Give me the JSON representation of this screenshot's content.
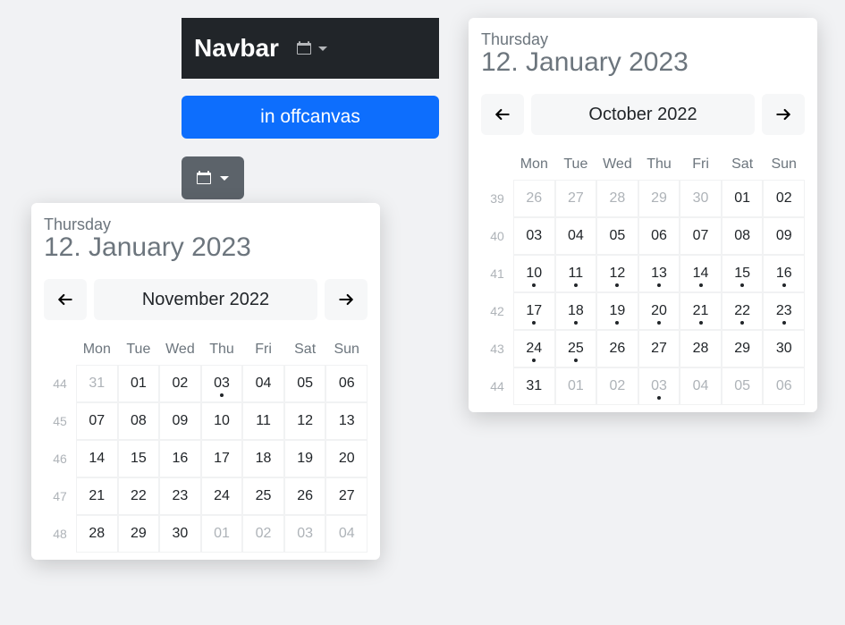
{
  "navbar": {
    "brand": "Navbar"
  },
  "offcanvas_btn": "in offcanvas",
  "picker_header": {
    "weekday": "Thursday",
    "date": "12. January 2023"
  },
  "weekdays": [
    "Mon",
    "Tue",
    "Wed",
    "Thu",
    "Fri",
    "Sat",
    "Sun"
  ],
  "left": {
    "title": "November 2022",
    "weeks": [
      {
        "num": "44",
        "days": [
          {
            "d": "31",
            "out": true,
            "dot": false
          },
          {
            "d": "01",
            "out": false,
            "dot": false
          },
          {
            "d": "02",
            "out": false,
            "dot": false
          },
          {
            "d": "03",
            "out": false,
            "dot": true
          },
          {
            "d": "04",
            "out": false,
            "dot": false
          },
          {
            "d": "05",
            "out": false,
            "dot": false
          },
          {
            "d": "06",
            "out": false,
            "dot": false
          }
        ]
      },
      {
        "num": "45",
        "days": [
          {
            "d": "07",
            "out": false,
            "dot": false
          },
          {
            "d": "08",
            "out": false,
            "dot": false
          },
          {
            "d": "09",
            "out": false,
            "dot": false
          },
          {
            "d": "10",
            "out": false,
            "dot": false
          },
          {
            "d": "11",
            "out": false,
            "dot": false
          },
          {
            "d": "12",
            "out": false,
            "dot": false
          },
          {
            "d": "13",
            "out": false,
            "dot": false
          }
        ]
      },
      {
        "num": "46",
        "days": [
          {
            "d": "14",
            "out": false,
            "dot": false
          },
          {
            "d": "15",
            "out": false,
            "dot": false
          },
          {
            "d": "16",
            "out": false,
            "dot": false
          },
          {
            "d": "17",
            "out": false,
            "dot": false
          },
          {
            "d": "18",
            "out": false,
            "dot": false
          },
          {
            "d": "19",
            "out": false,
            "dot": false
          },
          {
            "d": "20",
            "out": false,
            "dot": false
          }
        ]
      },
      {
        "num": "47",
        "days": [
          {
            "d": "21",
            "out": false,
            "dot": false
          },
          {
            "d": "22",
            "out": false,
            "dot": false
          },
          {
            "d": "23",
            "out": false,
            "dot": false
          },
          {
            "d": "24",
            "out": false,
            "dot": false
          },
          {
            "d": "25",
            "out": false,
            "dot": false
          },
          {
            "d": "26",
            "out": false,
            "dot": false
          },
          {
            "d": "27",
            "out": false,
            "dot": false
          }
        ]
      },
      {
        "num": "48",
        "days": [
          {
            "d": "28",
            "out": false,
            "dot": false
          },
          {
            "d": "29",
            "out": false,
            "dot": false
          },
          {
            "d": "30",
            "out": false,
            "dot": false
          },
          {
            "d": "01",
            "out": true,
            "dot": false
          },
          {
            "d": "02",
            "out": true,
            "dot": false
          },
          {
            "d": "03",
            "out": true,
            "dot": false
          },
          {
            "d": "04",
            "out": true,
            "dot": false
          }
        ]
      }
    ]
  },
  "right": {
    "title": "October 2022",
    "weeks": [
      {
        "num": "39",
        "days": [
          {
            "d": "26",
            "out": true,
            "dot": false
          },
          {
            "d": "27",
            "out": true,
            "dot": false
          },
          {
            "d": "28",
            "out": true,
            "dot": false
          },
          {
            "d": "29",
            "out": true,
            "dot": false
          },
          {
            "d": "30",
            "out": true,
            "dot": false
          },
          {
            "d": "01",
            "out": false,
            "dot": false
          },
          {
            "d": "02",
            "out": false,
            "dot": false
          }
        ]
      },
      {
        "num": "40",
        "days": [
          {
            "d": "03",
            "out": false,
            "dot": false
          },
          {
            "d": "04",
            "out": false,
            "dot": false
          },
          {
            "d": "05",
            "out": false,
            "dot": false
          },
          {
            "d": "06",
            "out": false,
            "dot": false
          },
          {
            "d": "07",
            "out": false,
            "dot": false
          },
          {
            "d": "08",
            "out": false,
            "dot": false
          },
          {
            "d": "09",
            "out": false,
            "dot": false
          }
        ]
      },
      {
        "num": "41",
        "days": [
          {
            "d": "10",
            "out": false,
            "dot": true
          },
          {
            "d": "11",
            "out": false,
            "dot": true
          },
          {
            "d": "12",
            "out": false,
            "dot": true
          },
          {
            "d": "13",
            "out": false,
            "dot": true
          },
          {
            "d": "14",
            "out": false,
            "dot": true
          },
          {
            "d": "15",
            "out": false,
            "dot": true
          },
          {
            "d": "16",
            "out": false,
            "dot": true
          }
        ]
      },
      {
        "num": "42",
        "days": [
          {
            "d": "17",
            "out": false,
            "dot": true
          },
          {
            "d": "18",
            "out": false,
            "dot": true
          },
          {
            "d": "19",
            "out": false,
            "dot": true
          },
          {
            "d": "20",
            "out": false,
            "dot": true
          },
          {
            "d": "21",
            "out": false,
            "dot": true
          },
          {
            "d": "22",
            "out": false,
            "dot": true
          },
          {
            "d": "23",
            "out": false,
            "dot": true
          }
        ]
      },
      {
        "num": "43",
        "days": [
          {
            "d": "24",
            "out": false,
            "dot": true
          },
          {
            "d": "25",
            "out": false,
            "dot": true
          },
          {
            "d": "26",
            "out": false,
            "dot": false
          },
          {
            "d": "27",
            "out": false,
            "dot": false
          },
          {
            "d": "28",
            "out": false,
            "dot": false
          },
          {
            "d": "29",
            "out": false,
            "dot": false
          },
          {
            "d": "30",
            "out": false,
            "dot": false
          }
        ]
      },
      {
        "num": "44",
        "days": [
          {
            "d": "31",
            "out": false,
            "dot": false
          },
          {
            "d": "01",
            "out": true,
            "dot": false
          },
          {
            "d": "02",
            "out": true,
            "dot": false
          },
          {
            "d": "03",
            "out": true,
            "dot": true
          },
          {
            "d": "04",
            "out": true,
            "dot": false
          },
          {
            "d": "05",
            "out": true,
            "dot": false
          },
          {
            "d": "06",
            "out": true,
            "dot": false
          }
        ]
      }
    ]
  }
}
